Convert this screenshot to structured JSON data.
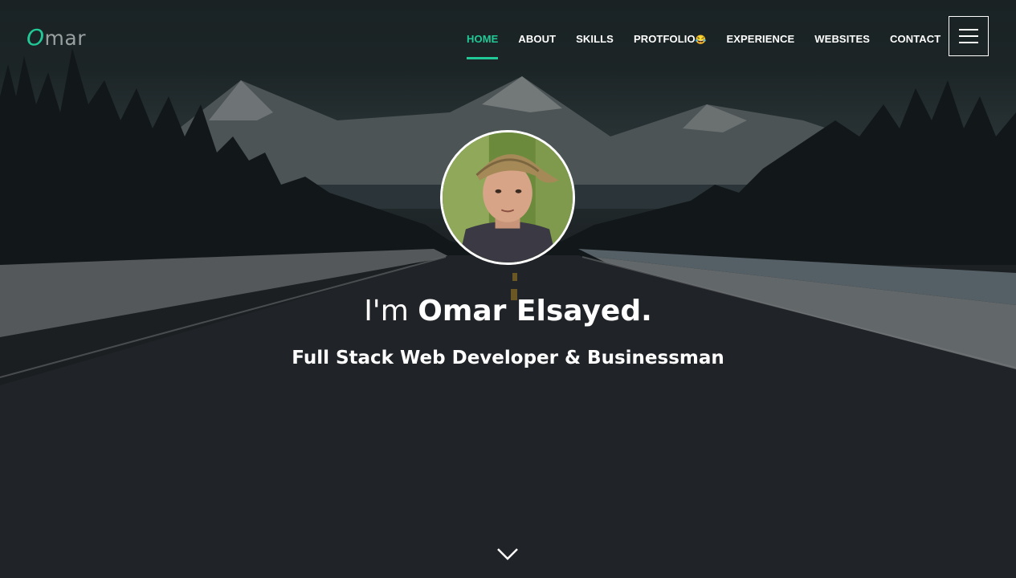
{
  "brand": {
    "logo_accent": "O",
    "logo_rest": "mar",
    "accent_color": "#20c997"
  },
  "nav": {
    "items": [
      {
        "label": "HOME",
        "active": true
      },
      {
        "label": "ABOUT"
      },
      {
        "label": "SKILLS"
      },
      {
        "label": "PROTFOLIO",
        "emoji": "😂"
      },
      {
        "label": "EXPERIENCE"
      },
      {
        "label": "WEBSITES"
      },
      {
        "label": "CONTACT"
      }
    ],
    "menu_icon": "hamburger-icon"
  },
  "hero": {
    "greeting": "I'm ",
    "name": "Omar Elsayed.",
    "subtitle": "Full Stack Web Developer & Businessman",
    "scroll_icon": "chevron-down-icon"
  }
}
